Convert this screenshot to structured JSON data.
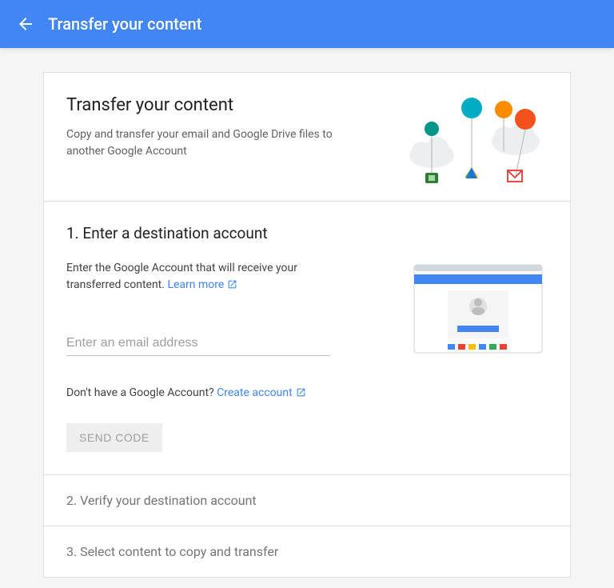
{
  "header": {
    "title": "Transfer your content"
  },
  "card": {
    "title": "Transfer your content",
    "subtitle": "Copy and transfer your email and Google Drive files to another Google Account"
  },
  "step1": {
    "title": "1. Enter a destination account",
    "text": "Enter the Google Account that will receive your transferred content. ",
    "learn_more": "Learn more",
    "email_placeholder": "Enter an email address",
    "no_account_text": "Don't have a Google Account? ",
    "create_account": "Create account",
    "send_code": "SEND CODE"
  },
  "step2": {
    "title": "2. Verify your destination account"
  },
  "step3": {
    "title": "3. Select content to copy and transfer"
  }
}
